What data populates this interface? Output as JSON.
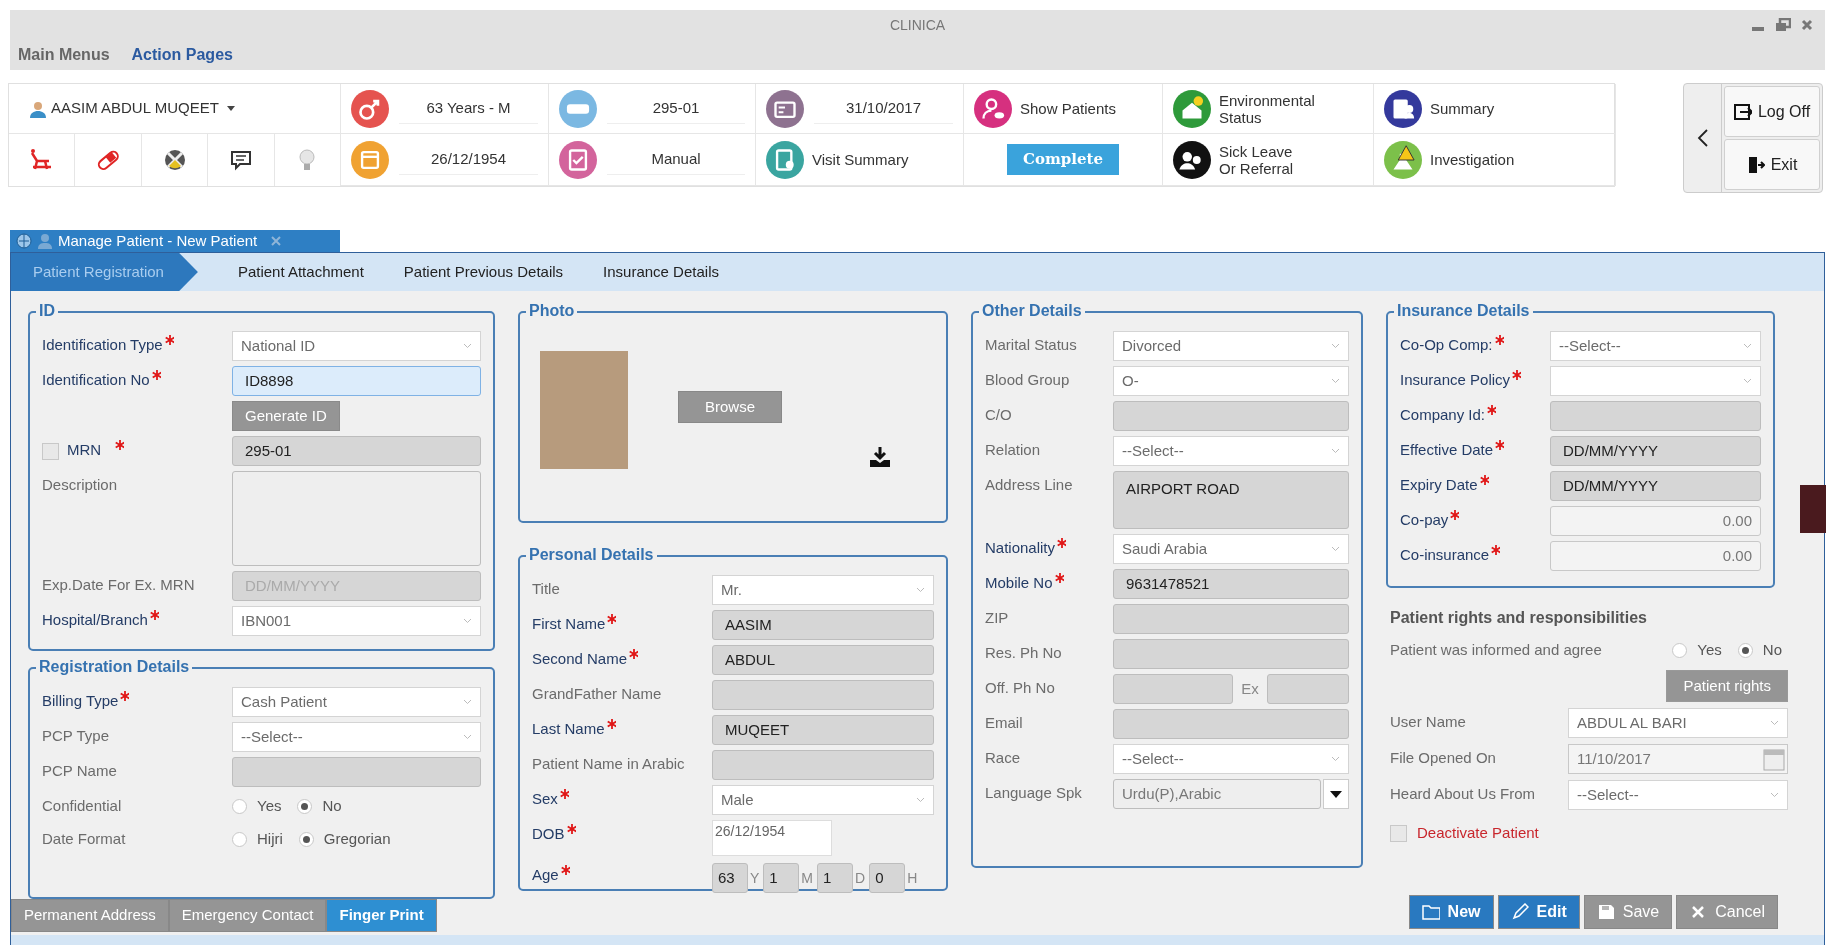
{
  "window": {
    "title": "CLINICA"
  },
  "menu": [
    {
      "label": "Main Menus",
      "selected": false
    },
    {
      "label": "Action Pages",
      "selected": true
    }
  ],
  "toolbar": {
    "patient_name": "AASIM ABDUL MUQEET",
    "cells": [
      {
        "kind": "info",
        "text": "63 Years - M"
      },
      {
        "kind": "info",
        "text": "295-01"
      },
      {
        "kind": "info",
        "text": "31/10/2017"
      },
      {
        "kind": "link",
        "lines": [
          "Show Patients"
        ]
      },
      {
        "kind": "link",
        "lines": [
          "Environmental",
          "Status"
        ]
      },
      {
        "kind": "link",
        "lines": [
          "Summary"
        ]
      },
      {
        "kind": "info",
        "text": "26/12/1954"
      },
      {
        "kind": "info",
        "text": "Manual"
      },
      {
        "kind": "link",
        "lines": [
          "Visit Summary"
        ]
      },
      {
        "kind": "status",
        "text": "Complete"
      },
      {
        "kind": "link",
        "lines": [
          "Sick Leave",
          "Or Referral"
        ]
      },
      {
        "kind": "link",
        "lines": [
          "Investigation"
        ]
      }
    ],
    "side_buttons": [
      {
        "kind": "logoff",
        "label": "Log Off"
      },
      {
        "kind": "exit",
        "label": "Exit"
      }
    ]
  },
  "document_tab": {
    "title": "Manage Patient - New Patient"
  },
  "tabs": [
    {
      "label": "Patient Registration",
      "selected": true
    },
    {
      "label": "Patient Attachment",
      "selected": false
    },
    {
      "label": "Patient Previous Details",
      "selected": false
    },
    {
      "label": "Insurance Details",
      "selected": false
    }
  ],
  "id_section": {
    "title": "ID",
    "fields": [
      {
        "kind": "select",
        "label": "Identification Type",
        "required": true,
        "value": "National ID"
      },
      {
        "kind": "text",
        "label": "Identification No",
        "required": true,
        "value": "ID8898",
        "focused": true
      },
      {
        "kind": "button",
        "label": "Generate ID",
        "disabled": true
      },
      {
        "kind": "check-text",
        "label": "MRN",
        "required": true,
        "checked": false,
        "value": "295-01"
      },
      {
        "kind": "textarea",
        "label": "Description",
        "required": false
      },
      {
        "kind": "text",
        "label": "Exp.Date For Ex. MRN",
        "required": false,
        "placeholder": "DD/MM/YYYY"
      },
      {
        "kind": "select",
        "label": "Hospital/Branch",
        "required": true,
        "value": "IBN001"
      }
    ]
  },
  "registration": {
    "title": "Registration Details",
    "fields": [
      {
        "kind": "select",
        "label": "Billing Type",
        "required": true,
        "value": "Cash Patient"
      },
      {
        "kind": "select",
        "label": "PCP Type",
        "required": false,
        "value": "--Select--"
      },
      {
        "kind": "text",
        "label": "PCP Name",
        "required": false
      },
      {
        "kind": "radio",
        "label": "Confidential",
        "options": [
          {
            "label": "Yes",
            "selected": false
          },
          {
            "label": "No",
            "selected": true
          }
        ]
      },
      {
        "kind": "radio",
        "label": "Date Format",
        "options": [
          {
            "label": "Hijri",
            "selected": false
          },
          {
            "label": "Gregorian",
            "selected": true
          }
        ]
      }
    ]
  },
  "photo": {
    "title": "Photo",
    "browse": {
      "label": "Browse",
      "disabled": true
    }
  },
  "personal": {
    "title": "Personal Details",
    "fields": [
      {
        "kind": "select",
        "label": "Title",
        "required": false,
        "value": "Mr."
      },
      {
        "kind": "text",
        "label": "First Name",
        "required": true,
        "value": "AASIM"
      },
      {
        "kind": "text",
        "label": "Second Name",
        "required": true,
        "value": "ABDUL"
      },
      {
        "kind": "text",
        "label": "GrandFather Name",
        "required": false
      },
      {
        "kind": "text",
        "label": "Last Name",
        "required": true,
        "value": "MUQEET"
      },
      {
        "kind": "text",
        "label": "Patient Name in Arabic",
        "required": false
      },
      {
        "kind": "select",
        "label": "Sex",
        "required": true,
        "value": "Male"
      },
      {
        "kind": "date-plain",
        "label": "DOB",
        "required": true,
        "value": "26/12/1954"
      },
      {
        "kind": "age",
        "label": "Age",
        "required": true,
        "parts": [
          {
            "value": "63",
            "unit": "Y"
          },
          {
            "value": "1",
            "unit": "M"
          },
          {
            "value": "1",
            "unit": "D"
          },
          {
            "value": "0",
            "unit": "H"
          }
        ]
      }
    ]
  },
  "other": {
    "title": "Other Details",
    "fields": [
      {
        "kind": "select",
        "label": "Marital Status",
        "required": false,
        "value": "Divorced"
      },
      {
        "kind": "select",
        "label": "Blood Group",
        "required": false,
        "value": "O-"
      },
      {
        "kind": "text",
        "label": "C/O",
        "required": false
      },
      {
        "kind": "select",
        "label": "Relation",
        "required": false,
        "value": "--Select--"
      },
      {
        "kind": "textarea",
        "label": "Address Line",
        "required": false,
        "value": "AIRPORT ROAD"
      },
      {
        "kind": "select",
        "label": "Nationality",
        "required": true,
        "value": "Saudi Arabia"
      },
      {
        "kind": "text",
        "label": "Mobile No",
        "required": true,
        "value": "9631478521"
      },
      {
        "kind": "text",
        "label": "ZIP",
        "required": false
      },
      {
        "kind": "text",
        "label": "Res. Ph No",
        "required": false
      },
      {
        "kind": "phone-ext",
        "label": "Off. Ph No",
        "required": false,
        "ext_label": "Ex"
      },
      {
        "kind": "text",
        "label": "Email",
        "required": false
      },
      {
        "kind": "select",
        "label": "Race",
        "required": false,
        "value": "--Select--"
      },
      {
        "kind": "multiselect",
        "label": "Language Spk",
        "required": false,
        "value": "Urdu(P),Arabic"
      }
    ]
  },
  "insurance": {
    "title": "Insurance Details",
    "fields": [
      {
        "kind": "select",
        "label": "Co-Op Comp:",
        "required": true,
        "value": "--Select--"
      },
      {
        "kind": "select",
        "label": "Insurance Policy",
        "required": true
      },
      {
        "kind": "text",
        "label": "Company Id:",
        "required": true
      },
      {
        "kind": "text",
        "label": "Effective Date",
        "required": true,
        "value": "DD/MM/YYYY"
      },
      {
        "kind": "text",
        "label": "Expiry Date",
        "required": true,
        "value": "DD/MM/YYYY"
      },
      {
        "kind": "number",
        "label": "Co-pay",
        "required": true,
        "value": "0.00"
      },
      {
        "kind": "number",
        "label": "Co-insurance",
        "required": true,
        "value": "0.00"
      }
    ]
  },
  "rights": {
    "title": "Patient rights and responsibilities",
    "fields": [
      {
        "kind": "radio",
        "label": "Patient was informed and agree",
        "options": [
          {
            "label": "Yes",
            "selected": false
          },
          {
            "label": "No",
            "selected": true
          }
        ]
      },
      {
        "kind": "button",
        "label": "Patient rights",
        "disabled": true
      },
      {
        "kind": "select",
        "label": "User Name",
        "required": false,
        "value": "ABDUL AL BARI"
      },
      {
        "kind": "date",
        "label": "File Opened On",
        "required": false,
        "value": "11/10/2017"
      },
      {
        "kind": "select",
        "label": "Heard About Us From",
        "required": false,
        "value": "--Select--"
      },
      {
        "kind": "checkbox",
        "label": "Deactivate Patient",
        "checked": false
      }
    ]
  },
  "bottom_tabs": [
    {
      "label": "Permanent Address",
      "selected": false
    },
    {
      "label": "Emergency Contact",
      "selected": false
    },
    {
      "label": "Finger Print",
      "selected": true
    }
  ],
  "actions": [
    {
      "kind": "new",
      "label": "New",
      "disabled": false
    },
    {
      "kind": "edit",
      "label": "Edit",
      "disabled": false
    },
    {
      "kind": "save",
      "label": "Save",
      "disabled": true
    },
    {
      "kind": "cancel",
      "label": "Cancel",
      "disabled": true
    }
  ]
}
